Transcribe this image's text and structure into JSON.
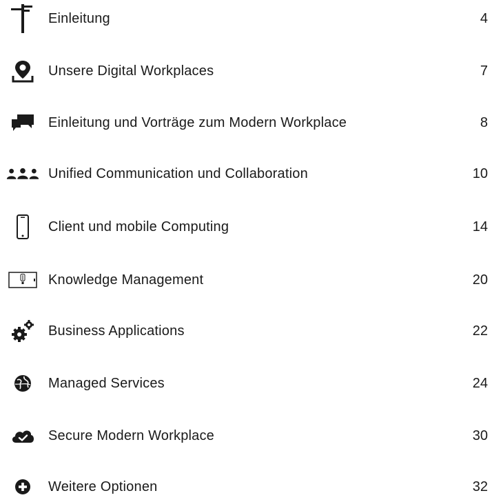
{
  "toc": {
    "items": [
      {
        "label": "Einleitung",
        "page": "4",
        "icon": "signpost-icon"
      },
      {
        "label": "Unsere Digital Workplaces",
        "page": "7",
        "icon": "location-pin-icon"
      },
      {
        "label": "Einleitung und Vorträge zum Modern Workplace",
        "page": "8",
        "icon": "speech-bubbles-icon"
      },
      {
        "label": "Unified Communication und Collaboration",
        "page": "10",
        "icon": "people-group-icon"
      },
      {
        "label": "Client und mobile Computing",
        "page": "14",
        "icon": "smartphone-icon"
      },
      {
        "label": "Knowledge Management",
        "page": "20",
        "icon": "lightbulb-tablet-icon"
      },
      {
        "label": "Business Applications",
        "page": "22",
        "icon": "gears-icon"
      },
      {
        "label": "Managed Services",
        "page": "24",
        "icon": "globe-icon"
      },
      {
        "label": "Secure Modern Workplace",
        "page": "30",
        "icon": "cloud-check-icon"
      },
      {
        "label": "Weitere Optionen",
        "page": "32",
        "icon": "plus-circle-icon"
      }
    ]
  },
  "colors": {
    "text": "#1a1a1a",
    "icon": "#1a1a1a",
    "background": "#ffffff"
  }
}
